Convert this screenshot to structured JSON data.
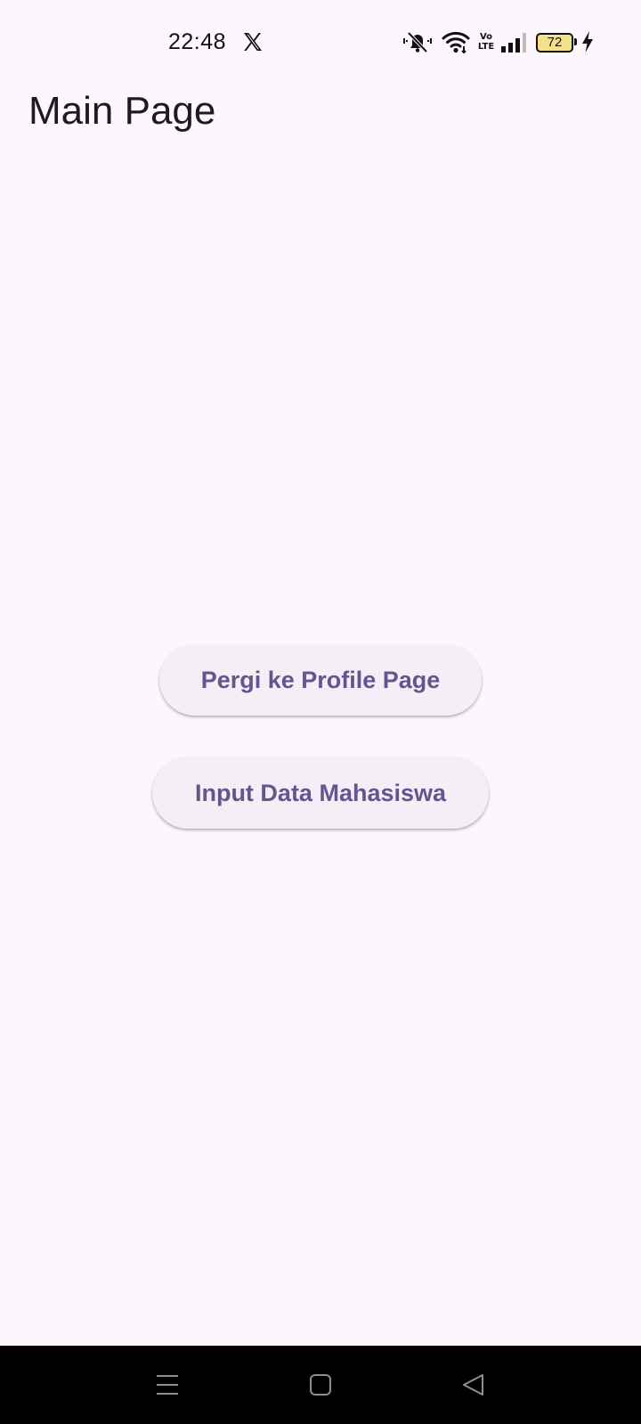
{
  "status_bar": {
    "time": "22:48",
    "battery_level": "72",
    "icons": [
      "x-icon",
      "mute-icon",
      "wifi-icon",
      "volte-icon",
      "signal-icon",
      "battery-icon",
      "charging-bolt-icon"
    ],
    "volte_label_top": "Vo",
    "volte_label_bottom": "LTE"
  },
  "app_bar": {
    "title": "Main Page"
  },
  "main": {
    "profile_button_label": "Pergi ke Profile Page",
    "input_button_label": "Input Data Mahasiswa"
  },
  "nav_bar": {
    "icons": [
      "menu-icon",
      "home-icon",
      "back-icon"
    ]
  },
  "colors": {
    "background": "#fdf7fd",
    "button_background": "#f4eff6",
    "button_text": "#65558f",
    "title_text": "#1d1b20",
    "battery_fill": "#f7e08a",
    "nav_background": "#000000",
    "nav_icon": "#8e8e8e"
  }
}
